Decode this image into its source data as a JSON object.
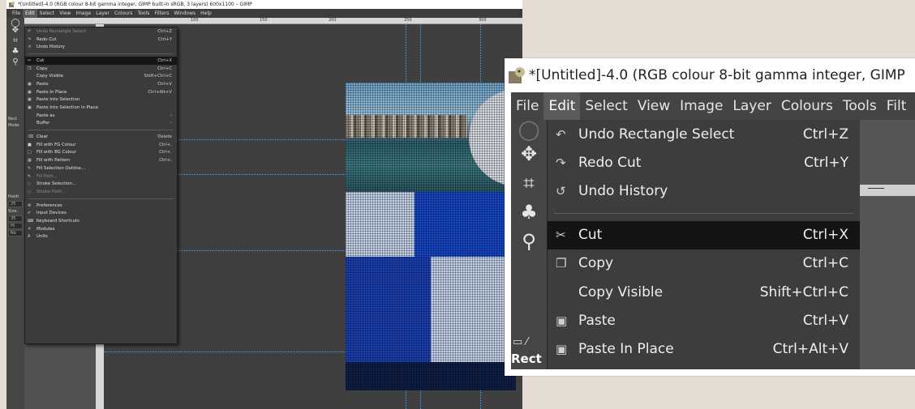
{
  "window": {
    "title_small": "*[Untitled]-4.0 (RGB colour 8-bit gamma integer, GIMP built-in sRGB, 3 layers) 600x1100 – GIMP",
    "title_zoom": "*[Untitled]-4.0 (RGB colour 8-bit gamma integer, GIMP"
  },
  "menubar": {
    "items": [
      "File",
      "Edit",
      "Select",
      "View",
      "Image",
      "Layer",
      "Colours",
      "Tools",
      "Filters",
      "Windows",
      "Help"
    ],
    "zoom_items": [
      "File",
      "Edit",
      "Select",
      "View",
      "Image",
      "Layer",
      "Colours",
      "Tools",
      "Filt"
    ]
  },
  "edit_menu": {
    "items": [
      {
        "label": "Undo Rectangle Select",
        "shortcut": "Ctrl+Z",
        "icon": "undo-icon"
      },
      {
        "label": "Redo Cut",
        "shortcut": "Ctrl+Y",
        "icon": "redo-icon"
      },
      {
        "label": "Undo History",
        "shortcut": "",
        "icon": "undo-history-icon"
      },
      {
        "label": "Cut",
        "shortcut": "Ctrl+X",
        "icon": "scissors-icon"
      },
      {
        "label": "Copy",
        "shortcut": "Ctrl+C",
        "icon": "copy-icon"
      },
      {
        "label": "Copy Visible",
        "shortcut": "Shift+Ctrl+C",
        "icon": ""
      },
      {
        "label": "Paste",
        "shortcut": "Ctrl+V",
        "icon": "paste-icon"
      },
      {
        "label": "Paste In Place",
        "shortcut": "Ctrl+Alt+V",
        "icon": "paste-icon"
      },
      {
        "label": "Paste Into Selection",
        "shortcut": "",
        "icon": "paste-icon"
      },
      {
        "label": "Paste Into Selection In Place",
        "shortcut": "",
        "icon": "paste-icon"
      },
      {
        "label": "Paste as",
        "shortcut": "›",
        "icon": ""
      },
      {
        "label": "Buffer",
        "shortcut": "›",
        "icon": ""
      },
      {
        "label": "Clear",
        "shortcut": "Delete",
        "icon": "clear-icon"
      },
      {
        "label": "Fill with FG Colour",
        "shortcut": "Ctrl+,",
        "icon": "fill-fg-icon"
      },
      {
        "label": "Fill with BG Colour",
        "shortcut": "Ctrl+.",
        "icon": "fill-bg-icon"
      },
      {
        "label": "Fill with Pattern",
        "shortcut": "Ctrl+;",
        "icon": "pattern-icon"
      },
      {
        "label": "Fill Selection Outline...",
        "shortcut": "",
        "icon": "outline-icon"
      },
      {
        "label": "Fill Path...",
        "shortcut": "",
        "icon": "path-icon"
      },
      {
        "label": "Stroke Selection...",
        "shortcut": "",
        "icon": "stroke-icon"
      },
      {
        "label": "Stroke Path...",
        "shortcut": "",
        "icon": "stroke-path-icon"
      },
      {
        "label": "Preferences",
        "shortcut": "",
        "icon": "preferences-icon"
      },
      {
        "label": "Input Devices",
        "shortcut": "",
        "icon": "input-devices-icon"
      },
      {
        "label": "Keyboard Shortcuts",
        "shortcut": "",
        "icon": "keyboard-icon"
      },
      {
        "label": "Modules",
        "shortcut": "",
        "icon": "modules-icon"
      },
      {
        "label": "Units",
        "shortcut": "",
        "icon": "units-icon"
      }
    ]
  },
  "toolbox": {
    "tool_options_label": "Rect",
    "mode_label": "Mode",
    "position_label": "Positi",
    "size_label": "Size:",
    "field_values": [
      "25",
      "35",
      "Hi",
      "No"
    ]
  },
  "ruler": {
    "ticks": [
      "100",
      "150",
      "200",
      "250",
      "300"
    ]
  }
}
